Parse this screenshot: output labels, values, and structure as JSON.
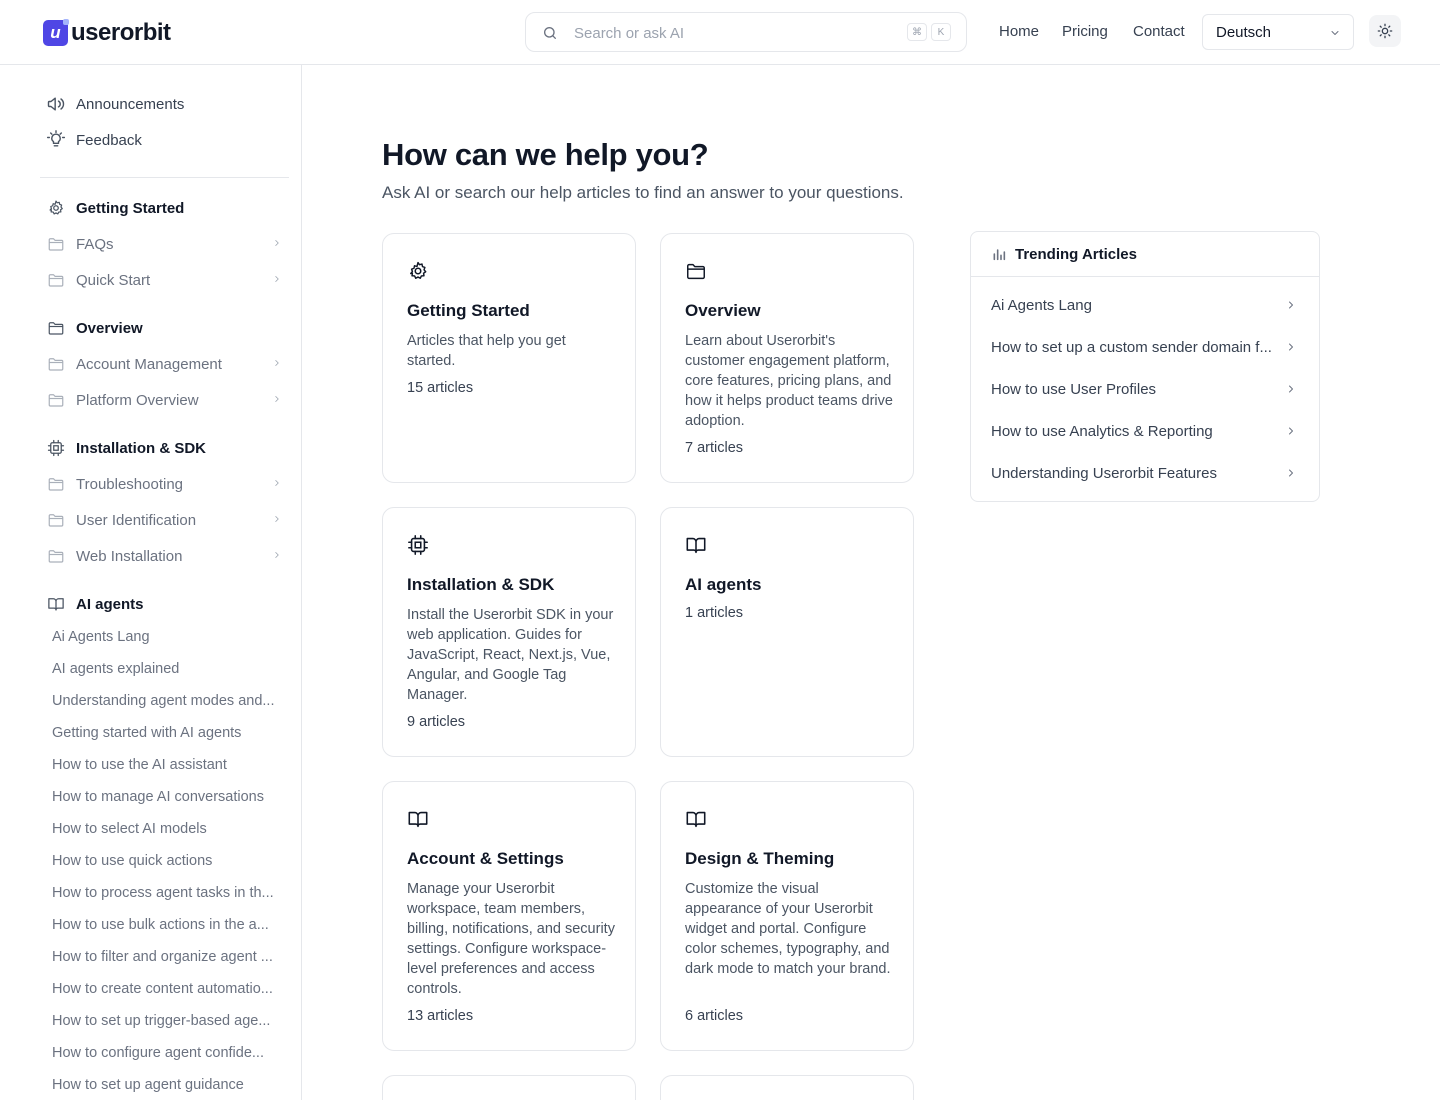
{
  "brand": {
    "name": "userorbit",
    "mark": "u"
  },
  "header": {
    "search_placeholder": "Search or ask AI",
    "search_shortcut": [
      "⌘",
      "K"
    ],
    "nav": [
      "Home",
      "Pricing",
      "Contact"
    ],
    "language": "Deutsch",
    "theme_icon": "sun-icon"
  },
  "sidebar": {
    "top_links": [
      {
        "label": "Announcements",
        "icon": "megaphone-icon"
      },
      {
        "label": "Feedback",
        "icon": "lightbulb-icon"
      }
    ],
    "sections": [
      {
        "label": "Getting Started",
        "icon": "gear-icon",
        "children": [
          "FAQs",
          "Quick Start"
        ]
      },
      {
        "label": "Overview",
        "icon": "folder-icon",
        "children": [
          "Account Management",
          "Platform Overview"
        ]
      },
      {
        "label": "Installation & SDK",
        "icon": "cpu-icon",
        "children": [
          "Troubleshooting",
          "User Identification",
          "Web Installation"
        ]
      },
      {
        "label": "AI agents",
        "icon": "book-icon",
        "articles": [
          "Ai Agents Lang",
          "AI agents explained",
          "Understanding agent modes and...",
          "Getting started with AI agents",
          "How to use the AI assistant",
          "How to manage AI conversations",
          "How to select AI models",
          "How to use quick actions",
          "How to process agent tasks in th...",
          "How to use bulk actions in the a...",
          "How to filter and organize agent ...",
          "How to create content automatio...",
          "How to set up trigger-based age...",
          "How to configure agent confide...",
          "How to set up agent guidance"
        ]
      }
    ]
  },
  "main": {
    "title": "How can we help you?",
    "subtitle": "Ask AI or search our help articles to find an answer to your questions.",
    "cards": [
      {
        "title": "Getting Started",
        "icon": "gear-icon",
        "description": "Articles that help you get started.",
        "count": "15 articles"
      },
      {
        "title": "Overview",
        "icon": "folder-icon",
        "description": "Learn about Userorbit's customer engagement platform, core features, pricing plans, and how it helps product teams drive adoption.",
        "count": "7 articles"
      },
      {
        "title": "Installation & SDK",
        "icon": "cpu-icon",
        "description": "Install the Userorbit SDK in your web application. Guides for JavaScript, React, Next.js, Vue, Angular, and Google Tag Manager.",
        "count": "9 articles"
      },
      {
        "title": "AI agents",
        "icon": "book-icon",
        "description": "",
        "count": "1 articles"
      },
      {
        "title": "Account & Settings",
        "icon": "book-icon",
        "description": "Manage your Userorbit workspace, team members, billing, notifications, and security settings. Configure workspace-level preferences and access controls.",
        "count": "13 articles"
      },
      {
        "title": "Design & Theming",
        "icon": "book-icon",
        "description": "Customize the visual appearance of your Userorbit widget and portal. Configure color schemes, typography, and dark mode to match your brand.",
        "count": "6 articles"
      }
    ],
    "trending": {
      "title": "Trending Articles",
      "icon": "bar-chart-icon",
      "items": [
        "Ai Agents Lang",
        "How to set up a custom sender domain f...",
        "How to use User Profiles",
        "How to use Analytics & Reporting",
        "Understanding Userorbit Features"
      ]
    }
  },
  "colors": {
    "brand": "#4f46e5",
    "border": "#e5e7eb",
    "text": "#111827",
    "muted": "#6b7280"
  }
}
